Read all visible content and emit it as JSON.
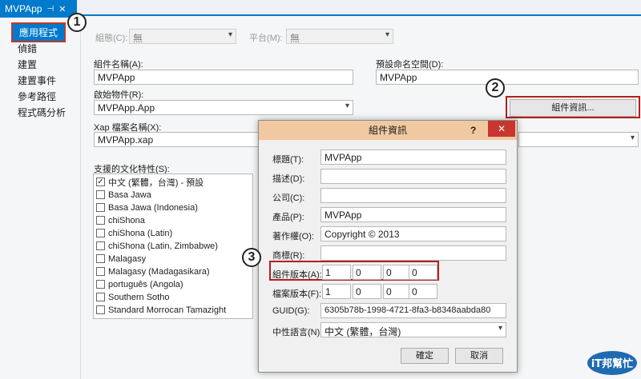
{
  "tab": {
    "title": "MVPApp",
    "pin_icon": "pin-icon",
    "close_icon": "close-icon"
  },
  "sidebar": {
    "items": [
      {
        "label": "應用程式"
      },
      {
        "label": "偵錯"
      },
      {
        "label": "建置"
      },
      {
        "label": "建置事件"
      },
      {
        "label": "參考路徑"
      },
      {
        "label": "程式碼分析"
      }
    ]
  },
  "config": {
    "configuration_label": "組態(C):",
    "configuration_value": "無",
    "platform_label": "平台(M):",
    "platform_value": "無"
  },
  "assembly": {
    "name_label": "組件名稱(A):",
    "name_value": "MVPApp",
    "namespace_label": "預設命名空間(D):",
    "namespace_value": "MVPApp",
    "startup_label": "啟始物件(R):",
    "startup_value": "MVPApp.App",
    "info_button": "組件資訊...",
    "xap_label": "Xap 檔案名稱(X):",
    "xap_value": "MVPApp.xap"
  },
  "cultures": {
    "label": "支援的文化特性(S):",
    "items": [
      {
        "label": "中文 (繁體，台灣) - 預設",
        "checked": "✓"
      },
      {
        "label": "Basa Jawa",
        "checked": ""
      },
      {
        "label": "Basa Jawa (Indonesia)",
        "checked": ""
      },
      {
        "label": "chiShona",
        "checked": ""
      },
      {
        "label": "chiShona (Latin)",
        "checked": ""
      },
      {
        "label": "chiShona (Latin, Zimbabwe)",
        "checked": ""
      },
      {
        "label": "Malagasy",
        "checked": ""
      },
      {
        "label": "Malagasy (Madagasikara)",
        "checked": ""
      },
      {
        "label": "português (Angola)",
        "checked": ""
      },
      {
        "label": "Southern Sotho",
        "checked": ""
      },
      {
        "label": "Standard Morrocan Tamazight",
        "checked": ""
      }
    ]
  },
  "dialog": {
    "title": "組件資訊",
    "help": "?",
    "close": "✕",
    "title_label": "標題(T):",
    "title_value": "MVPApp",
    "desc_label": "描述(D):",
    "desc_value": "",
    "company_label": "公司(C):",
    "company_value": "",
    "product_label": "產品(P):",
    "product_value": "MVPApp",
    "copyright_label": "著作權(O):",
    "copyright_value": "Copyright ©  2013",
    "trademark_label": "商標(R):",
    "trademark_value": "",
    "assembly_version_label": "組件版本(A):",
    "assembly_version": [
      "1",
      "0",
      "0",
      "0"
    ],
    "file_version_label": "檔案版本(F):",
    "file_version": [
      "1",
      "0",
      "0",
      "0"
    ],
    "guid_label": "GUID(G):",
    "guid_value": "6305b78b-1998-4721-8fa3-b8348aabda80",
    "neutral_label": "中性語言(N):",
    "neutral_value": "中文 (繁體，台灣)",
    "ok": "確定",
    "cancel": "取消"
  },
  "callouts": [
    "1",
    "2",
    "3"
  ],
  "watermark": {
    "text": "iT邦幫忙"
  }
}
